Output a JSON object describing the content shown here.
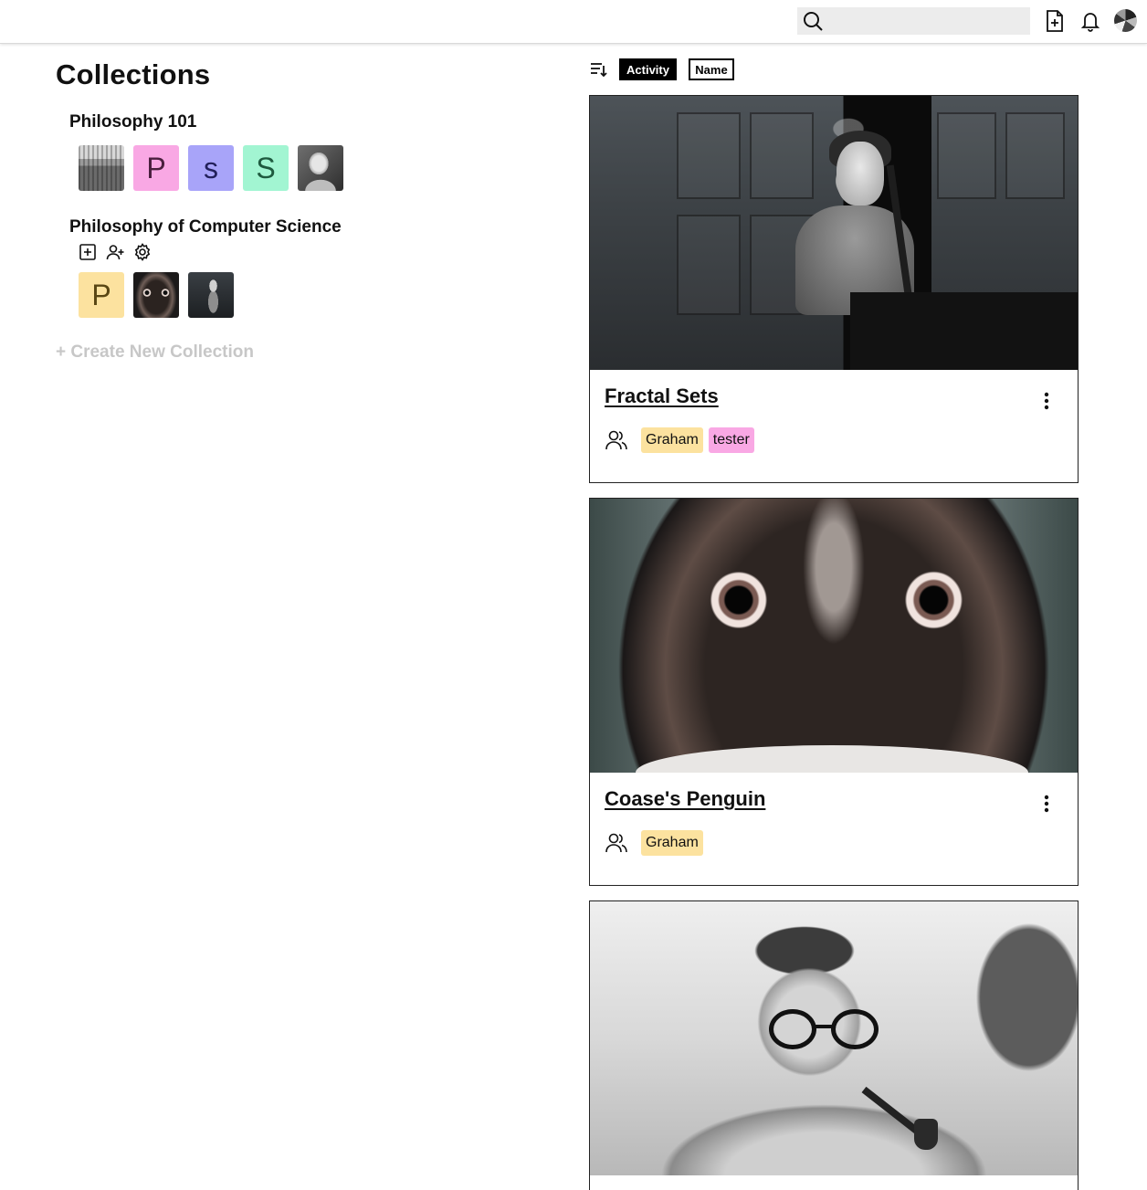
{
  "header": {
    "search": {
      "value": "",
      "placeholder": ""
    },
    "icons": [
      "search-icon",
      "new-document-icon",
      "bell-icon",
      "user-avatar"
    ]
  },
  "page": {
    "title": "Collections"
  },
  "collections": [
    {
      "name": "Philosophy 101",
      "tiles": [
        {
          "type": "image",
          "icon": "crowd-photo"
        },
        {
          "type": "letter",
          "letter": "P",
          "bg": "#F9A8E4",
          "fg": "#4a1f3e"
        },
        {
          "type": "letter",
          "letter": "s",
          "bg": "#A8A4F9",
          "fg": "#22205a"
        },
        {
          "type": "letter",
          "letter": "S",
          "bg": "#A2F5D2",
          "fg": "#1e5a3f"
        },
        {
          "type": "image",
          "icon": "portrait-photo"
        }
      ]
    },
    {
      "name": "Philosophy of Computer Science",
      "actions": [
        "add-document-icon",
        "add-user-icon",
        "settings-gear-icon"
      ],
      "tiles": [
        {
          "type": "letter",
          "letter": "P",
          "bg": "#FCE29F",
          "fg": "#5a4714"
        },
        {
          "type": "image",
          "icon": "penguin-photo"
        },
        {
          "type": "image",
          "icon": "lecture-photo"
        }
      ]
    }
  ],
  "create_new": "+ Create New Collection",
  "sort": {
    "activity_label": "Activity",
    "name_label": "Name",
    "active": "Activity"
  },
  "cards": [
    {
      "title": "Fractal Sets",
      "members": [
        {
          "name": "Graham",
          "bg": "#FCE29F"
        },
        {
          "name": "tester",
          "bg": "#F9A8E4"
        }
      ]
    },
    {
      "title": "Coase's Penguin",
      "members": [
        {
          "name": "Graham",
          "bg": "#FCE29F"
        }
      ]
    },
    {
      "title": "",
      "members": []
    }
  ]
}
